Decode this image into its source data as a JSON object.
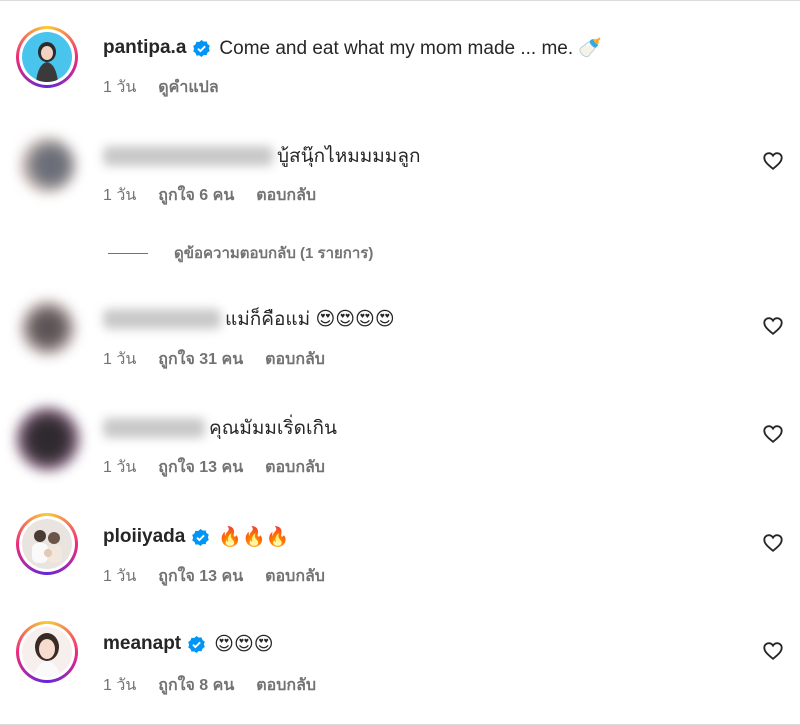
{
  "caption": {
    "username": "pantipa.a",
    "text": "Come and eat what my mom made ... me. 🍼",
    "time": "1 วัน",
    "translate": "ดูคำแปล"
  },
  "comments": [
    {
      "text": "บู้สนุ๊กไหมมมมลูก",
      "time": "1 วัน",
      "likes": "ถูกใจ 6 คน",
      "reply": "ตอบกลับ"
    },
    {
      "text": "แม่ก็คือแม่ 😍😍😍😍",
      "time": "1 วัน",
      "likes": "ถูกใจ 31 คน",
      "reply": "ตอบกลับ"
    },
    {
      "text": "คุณมัมมเริ่ดเกิน",
      "time": "1 วัน",
      "likes": "ถูกใจ 13 คน",
      "reply": "ตอบกลับ"
    },
    {
      "username": "ploiiyada",
      "text": "🔥🔥🔥",
      "time": "1 วัน",
      "likes": "ถูกใจ 13 คน",
      "reply": "ตอบกลับ"
    },
    {
      "username": "meanapt",
      "text": "😍😍😍",
      "time": "1 วัน",
      "likes": "ถูกใจ 8 คน",
      "reply": "ตอบกลับ"
    }
  ],
  "view_replies": "ดูข้อความตอบกลับ (1 รายการ)",
  "icons": {
    "verified": "verified-badge-icon",
    "like": "heart-outline-icon"
  },
  "colors": {
    "verified": "#0095f6",
    "meta": "#737373",
    "text": "#262626"
  }
}
